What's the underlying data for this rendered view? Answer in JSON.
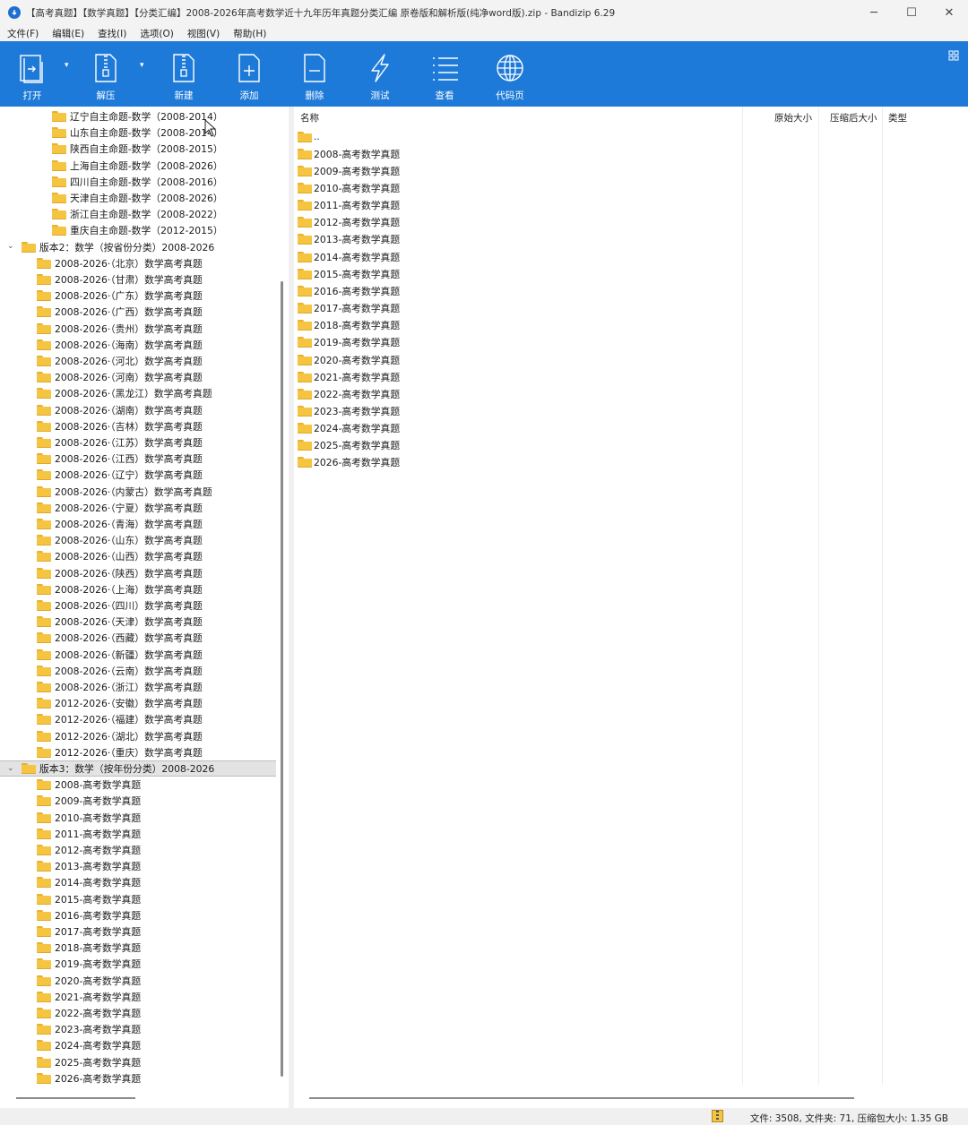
{
  "window": {
    "title": "【高考真题】【数学真题】【分类汇编】2008-2026年高考数学近十九年历年真题分类汇编  原卷版和解析版(纯净word版).zip - Bandizip 6.29",
    "minimize": "─",
    "maximize": "☐",
    "close": "✕"
  },
  "menu": [
    "文件(F)",
    "编辑(E)",
    "查找(I)",
    "选项(O)",
    "视图(V)",
    "帮助(H)"
  ],
  "toolbar": {
    "open": "打开",
    "extract": "解压",
    "new": "新建",
    "add": "添加",
    "delete": "删除",
    "test": "测试",
    "view": "查看",
    "codepage": "代码页"
  },
  "tree": {
    "group1_items": [
      "辽宁自主命题-数学（2008-2014）",
      "山东自主命题-数学（2008-2014）",
      "陕西自主命题-数学（2008-2015）",
      "上海自主命题-数学（2008-2026）",
      "四川自主命题-数学（2008-2016）",
      "天津自主命题-数学（2008-2026）",
      "浙江自主命题-数学（2008-2022）",
      "重庆自主命题-数学（2012-2015）"
    ],
    "group2_label": "版本2：数学（按省份分类）2008-2026",
    "group2_items": [
      "2008-2026·（北京）数学高考真题",
      "2008-2026·（甘肃）数学高考真题",
      "2008-2026·（广东）数学高考真题",
      "2008-2026·（广西）数学高考真题",
      "2008-2026·（贵州）数学高考真题",
      "2008-2026·（海南）数学高考真题",
      "2008-2026·（河北）数学高考真题",
      "2008-2026·（河南）数学高考真题",
      "2008-2026·（黑龙江）数学高考真题",
      "2008-2026·（湖南）数学高考真题",
      "2008-2026·（吉林）数学高考真题",
      "2008-2026·（江苏）数学高考真题",
      "2008-2026·（江西）数学高考真题",
      "2008-2026·（辽宁）数学高考真题",
      "2008-2026·（内蒙古）数学高考真题",
      "2008-2026·（宁夏）数学高考真题",
      "2008-2026·（青海）数学高考真题",
      "2008-2026·（山东）数学高考真题",
      "2008-2026·（山西）数学高考真题",
      "2008-2026·（陕西）数学高考真题",
      "2008-2026·（上海）数学高考真题",
      "2008-2026·（四川）数学高考真题",
      "2008-2026·（天津）数学高考真题",
      "2008-2026·（西藏）数学高考真题",
      "2008-2026·（新疆）数学高考真题",
      "2008-2026·（云南）数学高考真题",
      "2008-2026·（浙江）数学高考真题",
      "2012-2026·（安徽）数学高考真题",
      "2012-2026·（福建）数学高考真题",
      "2012-2026·（湖北）数学高考真题",
      "2012-2026·（重庆）数学高考真题"
    ],
    "group3_label": "版本3：数学（按年份分类）2008-2026",
    "group3_items": [
      "2008-高考数学真题",
      "2009-高考数学真题",
      "2010-高考数学真题",
      "2011-高考数学真题",
      "2012-高考数学真题",
      "2013-高考数学真题",
      "2014-高考数学真题",
      "2015-高考数学真题",
      "2016-高考数学真题",
      "2017-高考数学真题",
      "2018-高考数学真题",
      "2019-高考数学真题",
      "2020-高考数学真题",
      "2021-高考数学真题",
      "2022-高考数学真题",
      "2023-高考数学真题",
      "2024-高考数学真题",
      "2025-高考数学真题",
      "2026-高考数学真题"
    ]
  },
  "list": {
    "columns": {
      "name": "名称",
      "original_size": "原始大小",
      "compressed_size": "压缩后大小",
      "type": "类型"
    },
    "parent": "..",
    "items": [
      "2008-高考数学真题",
      "2009-高考数学真题",
      "2010-高考数学真题",
      "2011-高考数学真题",
      "2012-高考数学真题",
      "2013-高考数学真题",
      "2014-高考数学真题",
      "2015-高考数学真题",
      "2016-高考数学真题",
      "2017-高考数学真题",
      "2018-高考数学真题",
      "2019-高考数学真题",
      "2020-高考数学真题",
      "2021-高考数学真题",
      "2022-高考数学真题",
      "2023-高考数学真题",
      "2024-高考数学真题",
      "2025-高考数学真题",
      "2026-高考数学真题"
    ]
  },
  "status": {
    "summary": "文件: 3508, 文件夹: 71, 压缩包大小: 1.35 GB"
  }
}
